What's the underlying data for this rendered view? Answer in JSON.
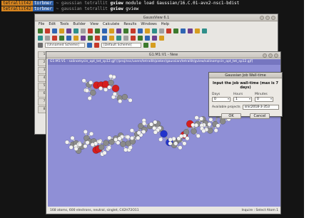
{
  "terminal": {
    "prompt_user": "tetrallit42",
    "prompt_host": "torbmer",
    "path1": "~ gaussian tetrallit",
    "cwd": "gview",
    "cmd1": "module load Gaussian/16.C.01-avx2-nsc1-bdist",
    "path2": "~ gaussian tetrallit",
    "cmd2": "gview"
  },
  "gaussview_main": {
    "title": "GaussView 6.1",
    "menu": [
      "File",
      "Edit",
      "Tools",
      "Builder",
      "View",
      "Calculate",
      "Results",
      "Windows",
      "Help"
    ],
    "scheme_left": "[Unnamed Scheme]",
    "scheme_right": "[Default Scheme]",
    "side_tabs": [
      "1",
      "2",
      "3",
      "4",
      "5",
      "6",
      "7",
      "8"
    ],
    "toolbar_colors": [
      "#3d7a2e",
      "#c63a2b",
      "#2f65b3",
      "#d69d1f",
      "#6d3f8f",
      "#2f8f8a",
      "#a0a0a0",
      "#c63a2b",
      "#3d7a2e",
      "#2f65b3",
      "#d69d1f",
      "#6d3f8f",
      "#3d7a2e",
      "#c63a2b",
      "#2f65b3",
      "#d69d1f",
      "#2f8f8a",
      "#a0a0a0",
      "#c63a2b",
      "#3d7a2e",
      "#2f65b3",
      "#6d3f8f",
      "#d69d1f",
      "#2f8f8a"
    ]
  },
  "molecule_window": {
    "title": "G1:M1:V1 - New",
    "view_title": "G1:M1:V1 - salinomycin_opt_tet_sp12.gjf [/proj/nsc/users/tetrallit/pieker/gaussian/tetrallit/gview/salinomycin_opt_tet_sp12.gjf]",
    "status_left": "168 atoms, 600 electrons, neutral, singlet, C42H72O11",
    "status_right": "Inquire : Select Atom 1"
  },
  "dialog": {
    "title": "Gaussian Job Wall-time",
    "heading": "Input the job wall-time (max is 7 days)",
    "days_label": "Days",
    "days_value": "0",
    "hours_label": "Hours",
    "hours_value": "1",
    "minutes_label": "Minutes",
    "minutes_value": "0",
    "project_label": "Available projects",
    "project_value": "snic2018-3-353",
    "ok_label": "OK",
    "cancel_label": "Cancel"
  },
  "colors": {
    "terminal_bg": "#141414",
    "view_bg": "#8f8fd6",
    "carbon": "#8a8a8a",
    "hydrogen": "#f2f2f2",
    "oxygen": "#d61e1e",
    "nitrogen": "#2233cc"
  }
}
